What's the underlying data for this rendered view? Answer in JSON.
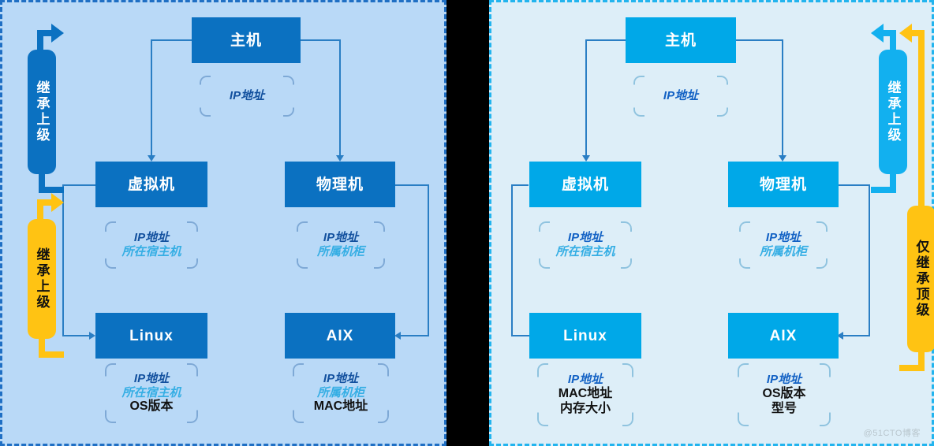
{
  "meta": {
    "watermark": "@51CTO博客",
    "colors": {
      "left_panel_bg": "#b9d9f7",
      "left_panel_border": "#1f6fc4",
      "left_node": "#0b71c1",
      "right_panel_bg": "#ddeef8",
      "right_panel_border": "#22b4ee",
      "right_node": "#00a8e8",
      "connector": "#2a7ec4",
      "gold": "#ffc313",
      "attr_dark": "#12509e",
      "attr_cyan": "#35aee4",
      "attr_black": "#111111"
    }
  },
  "left_panel": {
    "nodes": {
      "host": "主机",
      "vm": "虚拟机",
      "physical": "物理机",
      "linux": "Linux",
      "aix": "AIX"
    },
    "attributes": {
      "host": [
        {
          "text": "IP地址",
          "style": "dark"
        }
      ],
      "vm": [
        {
          "text": "IP地址",
          "style": "dark"
        },
        {
          "text": "所在宿主机",
          "style": "cyan"
        }
      ],
      "physical": [
        {
          "text": "IP地址",
          "style": "dark"
        },
        {
          "text": "所属机柜",
          "style": "cyan"
        }
      ],
      "linux": [
        {
          "text": "IP地址",
          "style": "dark"
        },
        {
          "text": "所在宿主机",
          "style": "cyan"
        },
        {
          "text": "OS版本",
          "style": "black"
        }
      ],
      "aix": [
        {
          "text": "IP地址",
          "style": "dark"
        },
        {
          "text": "所属机柜",
          "style": "cyan"
        },
        {
          "text": "MAC地址",
          "style": "black"
        }
      ]
    },
    "inherit_bars": [
      {
        "label": "继承上级",
        "color": "blue-dark"
      },
      {
        "label": "继承上级",
        "color": "gold"
      }
    ]
  },
  "right_panel": {
    "nodes": {
      "host": "主机",
      "vm": "虚拟机",
      "physical": "物理机",
      "linux": "Linux",
      "aix": "AIX"
    },
    "attributes": {
      "host": [
        {
          "text": "IP地址",
          "style": "dark"
        }
      ],
      "vm": [
        {
          "text": "IP地址",
          "style": "dark"
        },
        {
          "text": "所在宿主机",
          "style": "cyan"
        }
      ],
      "physical": [
        {
          "text": "IP地址",
          "style": "dark"
        },
        {
          "text": "所属机柜",
          "style": "cyan"
        }
      ],
      "linux": [
        {
          "text": "IP地址",
          "style": "dark"
        },
        {
          "text": "MAC地址",
          "style": "black"
        },
        {
          "text": "内存大小",
          "style": "black"
        }
      ],
      "aix": [
        {
          "text": "IP地址",
          "style": "dark"
        },
        {
          "text": "OS版本",
          "style": "black"
        },
        {
          "text": "型号",
          "style": "black"
        }
      ]
    },
    "inherit_bars": [
      {
        "label": "继承上级",
        "color": "cyan"
      },
      {
        "label": "仅继承顶级",
        "color": "gold"
      }
    ]
  }
}
